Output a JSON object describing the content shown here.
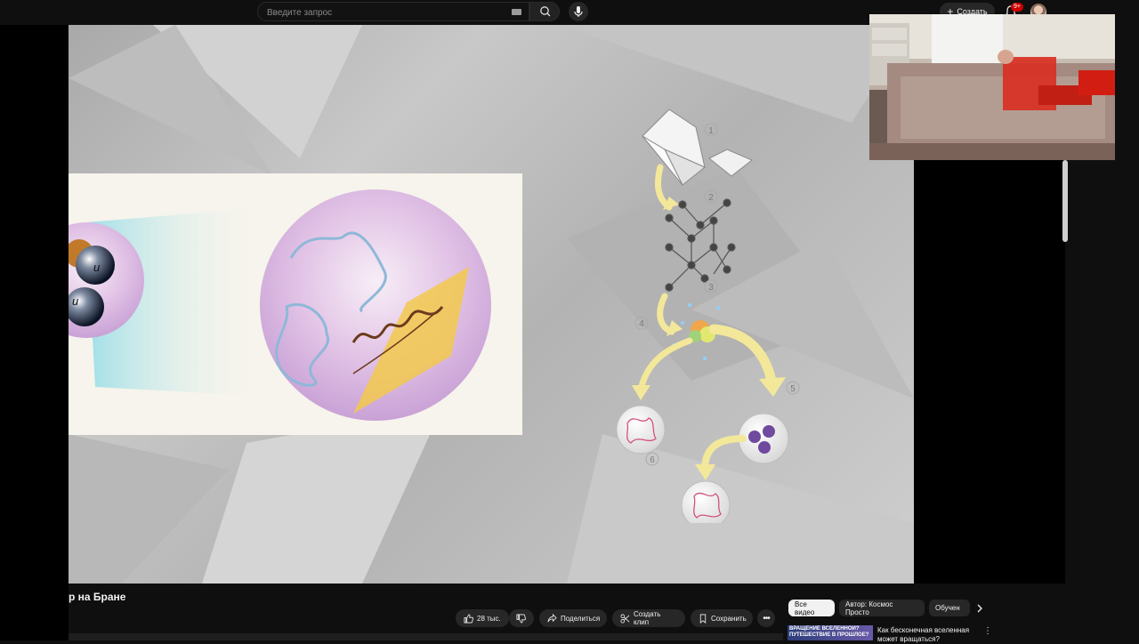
{
  "search": {
    "placeholder": "Введите запрос"
  },
  "header": {
    "create_label": "Создать",
    "notifications_badge": "9+"
  },
  "diagram": {
    "steps": [
      "1",
      "2",
      "3",
      "4",
      "5",
      "6"
    ],
    "quark_label_top": "u",
    "quark_label_bottom": "u"
  },
  "video": {
    "title": "р на Бране"
  },
  "actions": {
    "like_count": "28 тыс.",
    "share_label": "Поделиться",
    "clip_label": "Создать клип",
    "save_label": "Сохранить"
  },
  "filters": {
    "chips": [
      "Все видео",
      "Автор: Космос Просто",
      "Обучен"
    ]
  },
  "recommendation": {
    "thumb_text": "ВРАЩЕНИЕ ВСЕЛЕННОЙ? ПУТЕШЕСТВИЕ В ПРОШЛОЕ?",
    "title": "Как бесконечная вселенная может вращаться?"
  },
  "colors": {
    "accent_red": "#cc0000",
    "arrow_yellow": "#f3e89a",
    "sphere_violet": "#c9a2d6"
  }
}
